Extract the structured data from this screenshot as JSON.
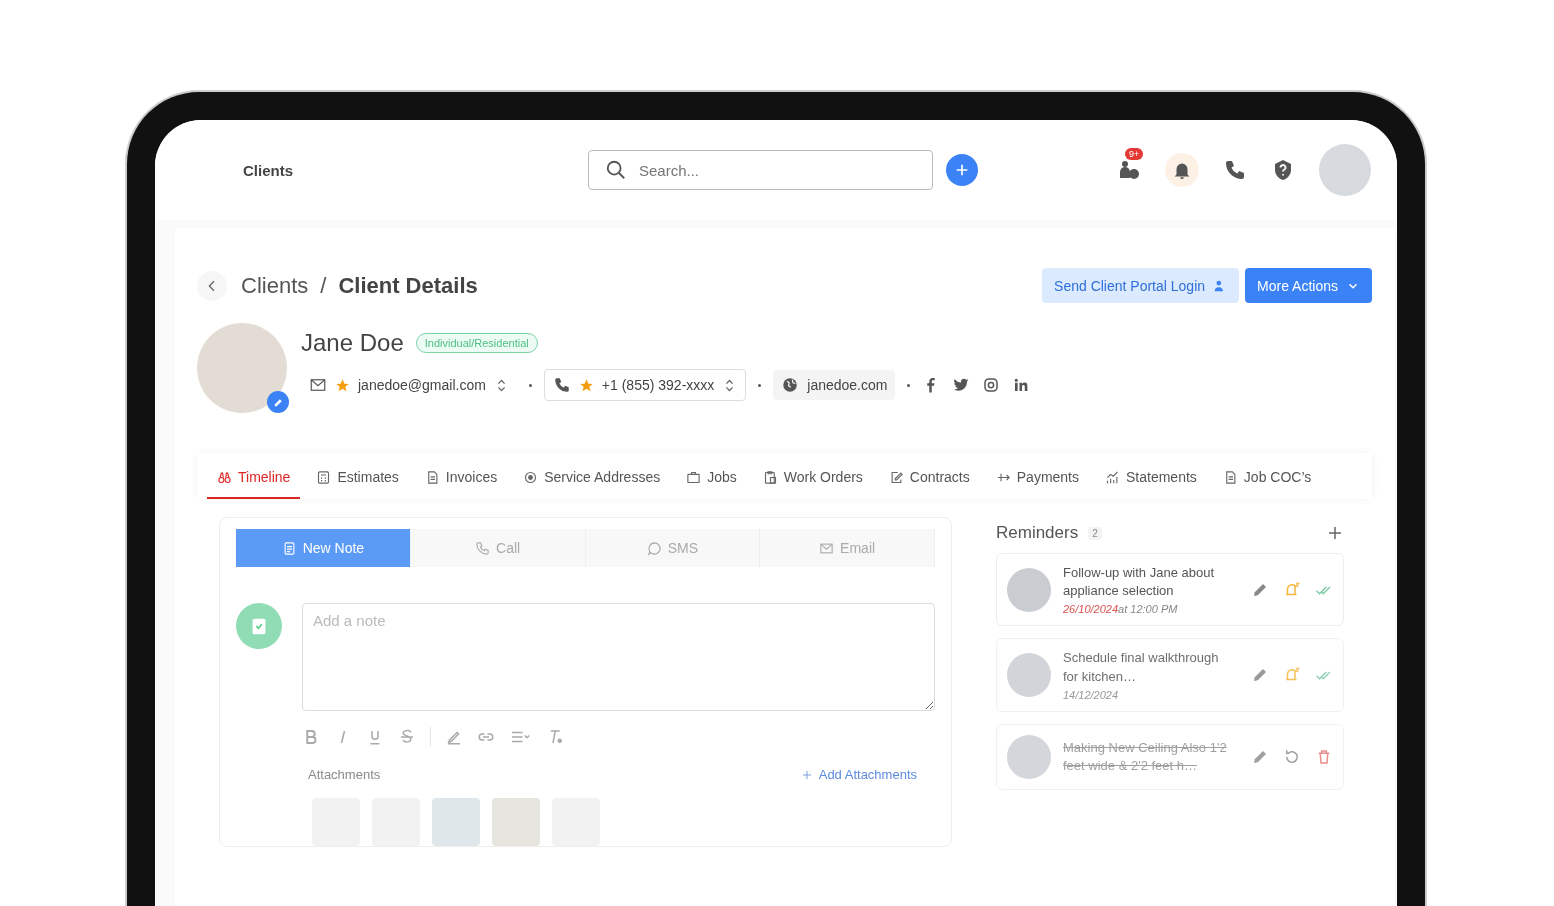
{
  "topbar": {
    "title": "Clients",
    "search": {
      "placeholder": "Search..."
    },
    "chat_badge": "9+"
  },
  "breadcrumb": {
    "parent": "Clients",
    "separator": "/",
    "current": "Client Details"
  },
  "actions": {
    "portal_login": "Send Client Portal Login",
    "more": "More Actions"
  },
  "client": {
    "name": "Jane Doe",
    "type": "Individual/Residential",
    "email": "janedoe@gmail.com",
    "phone": "+1 (855) 392-xxxx",
    "website": "janedoe.com"
  },
  "tabs": [
    {
      "label": "Timeline",
      "selected": true
    },
    {
      "label": "Estimates",
      "selected": false
    },
    {
      "label": "Invoices",
      "selected": false
    },
    {
      "label": "Service Addresses",
      "selected": false
    },
    {
      "label": "Jobs",
      "selected": false
    },
    {
      "label": "Work Orders",
      "selected": false
    },
    {
      "label": "Contracts",
      "selected": false
    },
    {
      "label": "Payments",
      "selected": false
    },
    {
      "label": "Statements",
      "selected": false
    },
    {
      "label": "Job COC’s",
      "selected": false
    }
  ],
  "note_tabs": [
    {
      "label": "New Note",
      "selected": true
    },
    {
      "label": "Call",
      "selected": false
    },
    {
      "label": "SMS",
      "selected": false
    },
    {
      "label": "Email",
      "selected": false
    }
  ],
  "note": {
    "placeholder": "Add a note",
    "attachments_label": "Attachments",
    "add_attachments": "Add Attachments"
  },
  "reminders": {
    "title": "Reminders",
    "count": "2",
    "items": [
      {
        "title": "Follow-up with Jane about appliance selection",
        "date": "26/10/2024",
        "time": "at 12:00 PM",
        "overdue": true,
        "done": false
      },
      {
        "title": "Schedule final walkthrough for kitchen…",
        "date": "14/12/2024",
        "overdue": false,
        "done": false
      },
      {
        "title": "Making New Ceiling Also 1'2 feet wide & 2'2 feet h…",
        "done": true
      }
    ]
  }
}
